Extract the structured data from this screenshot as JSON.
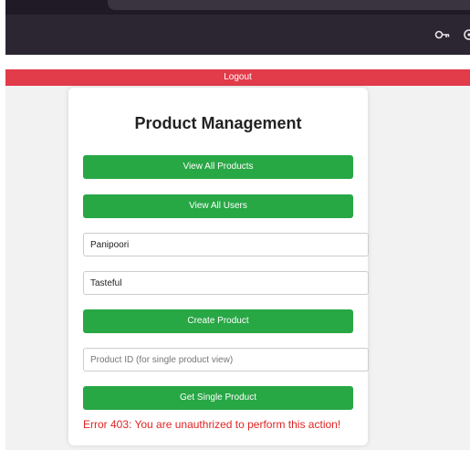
{
  "browser": {
    "toolbar_icons": [
      "key-icon",
      "extension-icon"
    ]
  },
  "header": {
    "logout_label": "Logout",
    "logout_color": "#e23b4a"
  },
  "main": {
    "title": "Product Management",
    "view_all_products_label": "View All Products",
    "view_all_users_label": "View All Users",
    "product_name_value": "Panipoori",
    "product_description_value": "Tasteful",
    "create_product_label": "Create Product",
    "product_id_placeholder": "Product ID (for single product view)",
    "get_single_product_label": "Get Single Product",
    "error_message": "Error 403: You are unauthrized to perform this action!"
  },
  "colors": {
    "button_green": "#28a745",
    "error_red": "#e02424"
  }
}
